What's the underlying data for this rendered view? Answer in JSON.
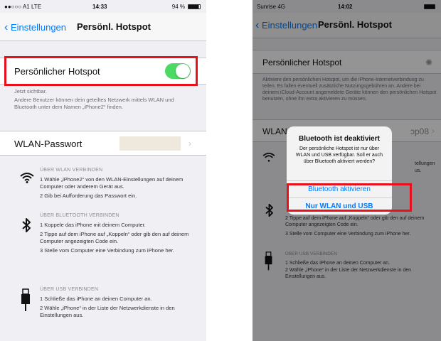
{
  "left": {
    "status": {
      "carrier": "●●○○○ A1  LTE",
      "time": "14:33",
      "battery": "94 %"
    },
    "nav": {
      "back_label": "Einstellungen",
      "title": "Persönl. Hotspot"
    },
    "hotspot_label": "Persönlicher Hotspot",
    "hotspot_on": true,
    "footer_status": "Jetzt sichtbar.",
    "footer_text": "Andere Benutzer können dein geteiltes Netzwerk mittels WLAN und Bluetooth unter dem Namen „iPhone2“ finden.",
    "wlan_label": "WLAN-Passwort",
    "sections": [
      {
        "icon": "wifi-icon",
        "glyph": "📶",
        "title": "ÜBER WLAN VERBINDEN",
        "steps": [
          "1 Wähle „iPhone2“ von den WLAN-Einstellungen auf deinem Computer oder anderem Gerät aus.",
          "2 Gib bei Aufforderung das Passwort ein."
        ]
      },
      {
        "icon": "bluetooth-icon",
        "glyph": "ᛒ",
        "title": "ÜBER BLUETOOTH VERBINDEN",
        "steps": [
          "1 Koppele das iPhone mit deinem Computer.",
          "2 Tippe auf dem iPhone auf „Koppeln“ oder gib den auf deinem Computer angezeigten Code ein.",
          "3 Stelle vom Computer eine Verbindung zum iPhone her."
        ]
      },
      {
        "icon": "usb-icon",
        "glyph": "🔌",
        "title": "ÜBER USB VERBINDEN",
        "steps": [
          "1 Schließe das iPhone an deinen Computer an.",
          "2 Wähle „iPhone“ in der Liste der Netzwerkdienste in den Einstellungen aus."
        ]
      }
    ]
  },
  "right": {
    "status": {
      "carrier": "Sunrise  4G",
      "time": "14:02"
    },
    "nav": {
      "back_label": "Einstellungen",
      "title": "Persönl. Hotspot"
    },
    "hotspot_label": "Persönlicher Hotspot",
    "footer_text": "Aktiviere den persönlichen Hotspot, um die iPhone-Internetverbindung zu teilen. Es fallen eventuell zusätzliche Nutzungsgebühren an. Andere bei deinem iCloud-Account angemeldete Geräte können den persönlichen Hotspot benutzen, ohne ihn extra aktivieren zu müssen.",
    "wlan_label": "WLAN-",
    "wlan_value": "ɔp08",
    "peek_wlan": "tellungen",
    "peek_wlan2": "us.",
    "bt_step2": "2 Tippe auf dem iPhone auf „Koppeln“ oder gib den auf deinem Computer angezeigten Code ein.",
    "bt_step3": "3 Stelle vom Computer eine Verbindung zum iPhone her.",
    "usb_title": "ÜBER USB VERBINDEN",
    "usb_steps": [
      "1 Schließe das iPhone an deinen Computer an.",
      "2 Wähle „iPhone“ in der Liste der Netzwerkdienste in den Einstellungen aus."
    ],
    "alert": {
      "title": "Bluetooth ist deaktiviert",
      "message": "Der persönliche Hotspot ist nur über WLAN und USB verfügbar. Soll er auch über Bluetooth aktiviert werden?",
      "btn_bluetooth": "Bluetooth aktivieren",
      "btn_wlan_usb": "Nur WLAN und USB"
    }
  },
  "colors": {
    "accent": "#007aff",
    "toggle_on": "#4cd964",
    "highlight": "#e8101a"
  }
}
